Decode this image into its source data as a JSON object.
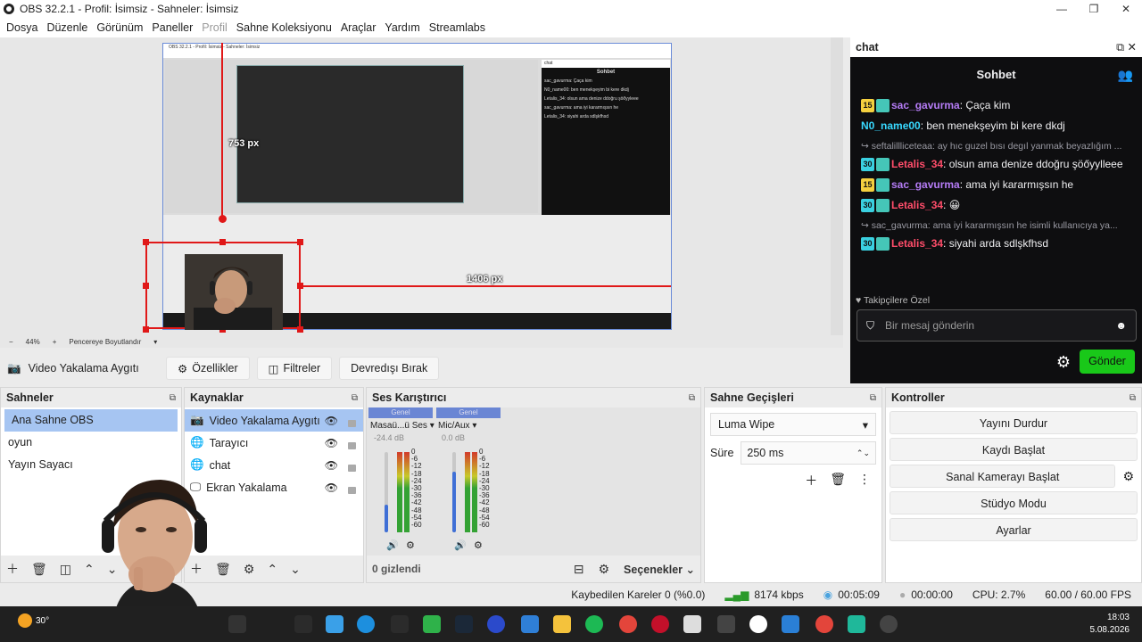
{
  "window": {
    "title": "OBS 32.2.1 - Profil: İsimsiz - Sahneler: İsimsiz",
    "min": "—",
    "max": "❐",
    "close": "✕"
  },
  "menu": [
    "Dosya",
    "Düzenle",
    "Görünüm",
    "Paneller",
    "Profil",
    "Sahne Koleksiyonu",
    "Araçlar",
    "Yardım",
    "Streamlabs"
  ],
  "preview": {
    "label_753": "753 px",
    "label_1406": "1406 px",
    "zoom": "44%",
    "zoom_minus": "−",
    "zoom_plus": "+",
    "fit_label": "Pencereye Boyutlandır",
    "mini_chat_head": "chat",
    "mini_chat_title": "Sohbet",
    "mini_chat_lines": [
      "sac_gavurma: Çaça kim",
      "N0_name00: ben menekşeyim bi kere dkdj",
      "Letalis_34: olsun ama denize ddoğru şöőyyleee",
      "sac_gavurma: ama iyi kararmışsın he",
      "Letalis_34: siyahi arda sdlşkfhsd"
    ]
  },
  "source_toolbar": {
    "source_name": "Video Yakalama Aygıtı",
    "properties": "Özellikler",
    "filters": "Filtreler",
    "deactivate": "Devredışı Bırak"
  },
  "scenes": {
    "title": "Sahneler",
    "items": [
      "Ana Sahne OBS",
      "oyun",
      "Yayın Sayacı"
    ]
  },
  "sources": {
    "title": "Kaynaklar",
    "items": [
      {
        "label": "Video Yakalama Aygıtı",
        "icon": "camera-icon"
      },
      {
        "label": "Tarayıcı",
        "icon": "globe-icon"
      },
      {
        "label": "chat",
        "icon": "globe-icon"
      },
      {
        "label": "Ekran Yakalama",
        "icon": "monitor-icon"
      }
    ]
  },
  "mixer": {
    "title": "Ses Karıştırıcı",
    "channels": [
      {
        "tag": "Genel",
        "name": "Masaü...ü Ses",
        "db": "-24.4 dB",
        "level": 0.35
      },
      {
        "tag": "Genel",
        "name": "Mic/Aux",
        "db": "0.0 dB",
        "level": 0.75
      }
    ],
    "scale": [
      "0",
      "-6",
      "-12",
      "-18",
      "-24",
      "-30",
      "-36",
      "-42",
      "-48",
      "-54",
      "-60"
    ],
    "hidden": "0 gizlendi",
    "options": "Seçenekler"
  },
  "transitions": {
    "title": "Sahne Geçişleri",
    "selected": "Luma Wipe",
    "duration_label": "Süre",
    "duration": "250 ms"
  },
  "controls": {
    "title": "Kontroller",
    "buttons": [
      "Yayını Durdur",
      "Kaydı Başlat",
      "Sanal Kamerayı Başlat",
      "Stüdyo Modu",
      "Ayarlar"
    ]
  },
  "status": {
    "dropped": "Kaybedilen Kareler 0 (%0.0)",
    "bitrate": "8174 kbps",
    "stream_time": "00:05:09",
    "rec_time": "00:00:00",
    "cpu": "CPU: 2.7%",
    "fps": "60.00 / 60.00 FPS"
  },
  "chat": {
    "dock_title": "chat",
    "header": "Sohbet",
    "messages": [
      {
        "type": "msg",
        "badge": "15",
        "user": "sac_gavurma",
        "ucolor": "purple",
        "text": ": Çaça kim"
      },
      {
        "type": "msg",
        "badge": "",
        "user": "N0_name00",
        "ucolor": "cyan",
        "text": ": ben menekşeyim bi kere dkdj"
      },
      {
        "type": "reply",
        "text": "↪ seftalillliceteaa: ay hıc guzel bısı degıl yanmak beyazlığım ..."
      },
      {
        "type": "msg",
        "badge": "30",
        "user": "Letalis_34",
        "ucolor": "red",
        "text": ": olsun ama denize ddoğru şöőyylleee"
      },
      {
        "type": "msg",
        "badge": "15",
        "user": "sac_gavurma",
        "ucolor": "purple",
        "text": ": ama iyi kararmışsın he"
      },
      {
        "type": "msg",
        "badge": "30",
        "user": "Letalis_34",
        "ucolor": "red",
        "text": ": 😀"
      },
      {
        "type": "reply",
        "text": "↪ sac_gavurma: ama iyi kararmışsın he isimli kullanıcıya ya..."
      },
      {
        "type": "msg",
        "badge": "30",
        "user": "Letalis_34",
        "ucolor": "red",
        "text": ": siyahi arda sdlşkfhsd"
      }
    ],
    "followers": "Takipçilere Özel",
    "placeholder": "Bir mesaj gönderin",
    "send": "Gönder"
  },
  "taskbar": {
    "temp": "30°",
    "time": "18:03",
    "date": "5.08.2026"
  }
}
